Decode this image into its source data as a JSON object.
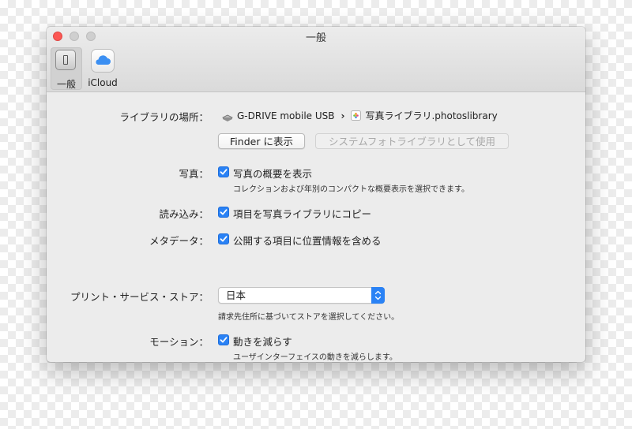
{
  "window": {
    "title": "一般",
    "controls": [
      "close",
      "minimize",
      "zoom"
    ]
  },
  "toolbar": {
    "items": [
      {
        "label": "一般",
        "icon": "general-switch-icon",
        "selected": true
      },
      {
        "label": "iCloud",
        "icon": "icloud-icon",
        "selected": false
      }
    ]
  },
  "library": {
    "label": "ライブラリの場所：",
    "drive": "G-DRIVE mobile USB",
    "separator": "›",
    "library_name": "写真ライブラリ.photoslibrary",
    "finder_button": "Finder に表示",
    "system_button": "システムフォトライブラリとして使用"
  },
  "photos": {
    "label": "写真：",
    "checkbox": "写真の概要を表示",
    "checked": true,
    "description": "コレクションおよび年別のコンパクトな概要表示を選択できます。"
  },
  "import": {
    "label": "読み込み：",
    "checkbox": "項目を写真ライブラリにコピー",
    "checked": true
  },
  "metadata": {
    "label": "メタデータ：",
    "checkbox": "公開する項目に位置情報を含める",
    "checked": true
  },
  "print": {
    "label": "プリント・サービス・ストア：",
    "selected": "日本",
    "description": "請求先住所に基づいてストアを選択してください。"
  },
  "motion": {
    "label": "モーション：",
    "checkbox": "動きを減らす",
    "checked": true,
    "description": "ユーザインターフェイスの動きを減らします。"
  },
  "colors": {
    "accent": "#2a82f5",
    "close": "#fc5753",
    "window_bg": "#ececec"
  }
}
